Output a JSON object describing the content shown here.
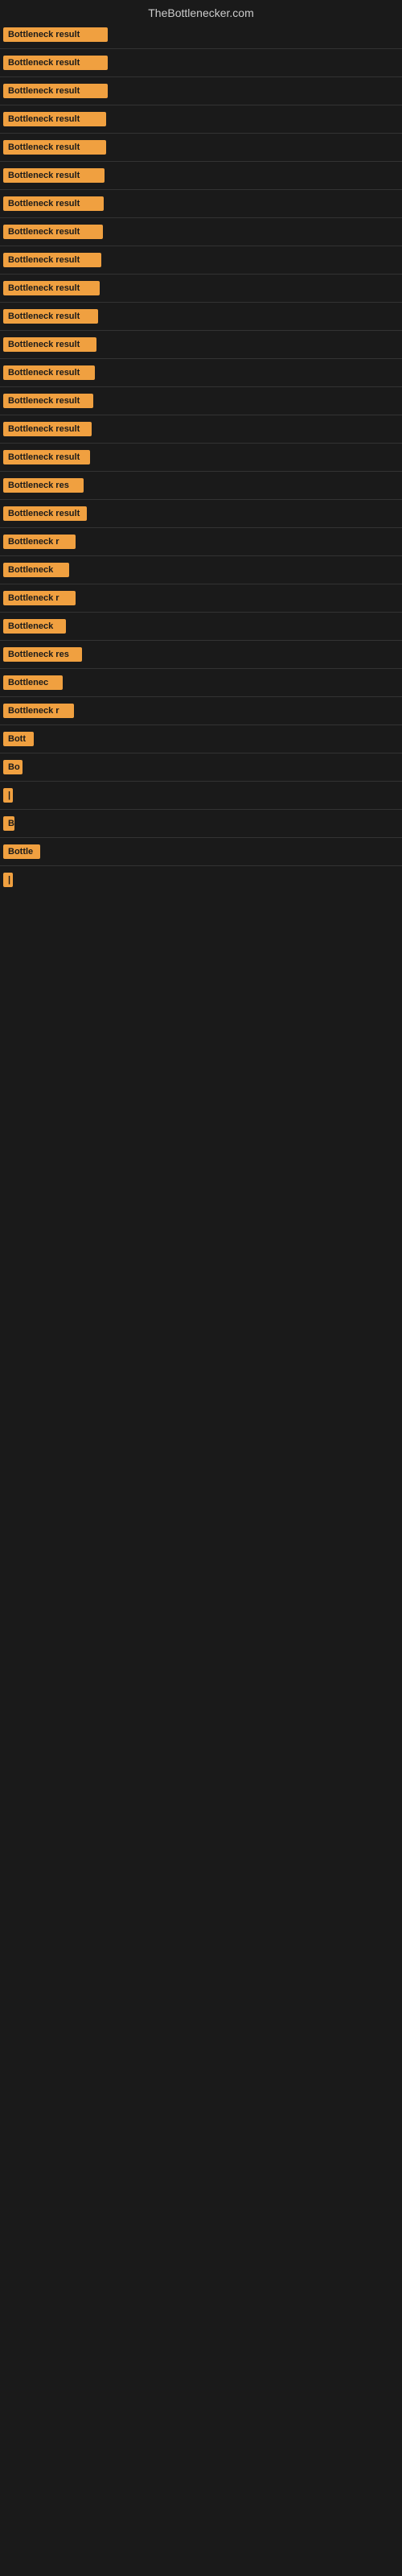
{
  "site": {
    "title": "TheBottlenecker.com"
  },
  "items": [
    {
      "label": "Bottleneck result",
      "width": 130
    },
    {
      "label": "Bottleneck result",
      "width": 130
    },
    {
      "label": "Bottleneck result",
      "width": 130
    },
    {
      "label": "Bottleneck result",
      "width": 128
    },
    {
      "label": "Bottleneck result",
      "width": 128
    },
    {
      "label": "Bottleneck result",
      "width": 126
    },
    {
      "label": "Bottleneck result",
      "width": 125
    },
    {
      "label": "Bottleneck result",
      "width": 124
    },
    {
      "label": "Bottleneck result",
      "width": 122
    },
    {
      "label": "Bottleneck result",
      "width": 120
    },
    {
      "label": "Bottleneck result",
      "width": 118
    },
    {
      "label": "Bottleneck result",
      "width": 116
    },
    {
      "label": "Bottleneck result",
      "width": 114
    },
    {
      "label": "Bottleneck result",
      "width": 112
    },
    {
      "label": "Bottleneck result",
      "width": 110
    },
    {
      "label": "Bottleneck result",
      "width": 108
    },
    {
      "label": "Bottleneck res",
      "width": 100
    },
    {
      "label": "Bottleneck result",
      "width": 104
    },
    {
      "label": "Bottleneck r",
      "width": 90
    },
    {
      "label": "Bottleneck",
      "width": 82
    },
    {
      "label": "Bottleneck r",
      "width": 90
    },
    {
      "label": "Bottleneck",
      "width": 78
    },
    {
      "label": "Bottleneck res",
      "width": 98
    },
    {
      "label": "Bottlenec",
      "width": 74
    },
    {
      "label": "Bottleneck r",
      "width": 88
    },
    {
      "label": "Bott",
      "width": 38
    },
    {
      "label": "Bo",
      "width": 24
    },
    {
      "label": "|",
      "width": 8
    },
    {
      "label": "B",
      "width": 14
    },
    {
      "label": "Bottle",
      "width": 46
    },
    {
      "label": "|",
      "width": 6
    }
  ],
  "colors": {
    "badge_bg": "#f0a040",
    "badge_text": "#1a1a1a",
    "body_bg": "#1a1a1a",
    "title_color": "#cccccc"
  }
}
